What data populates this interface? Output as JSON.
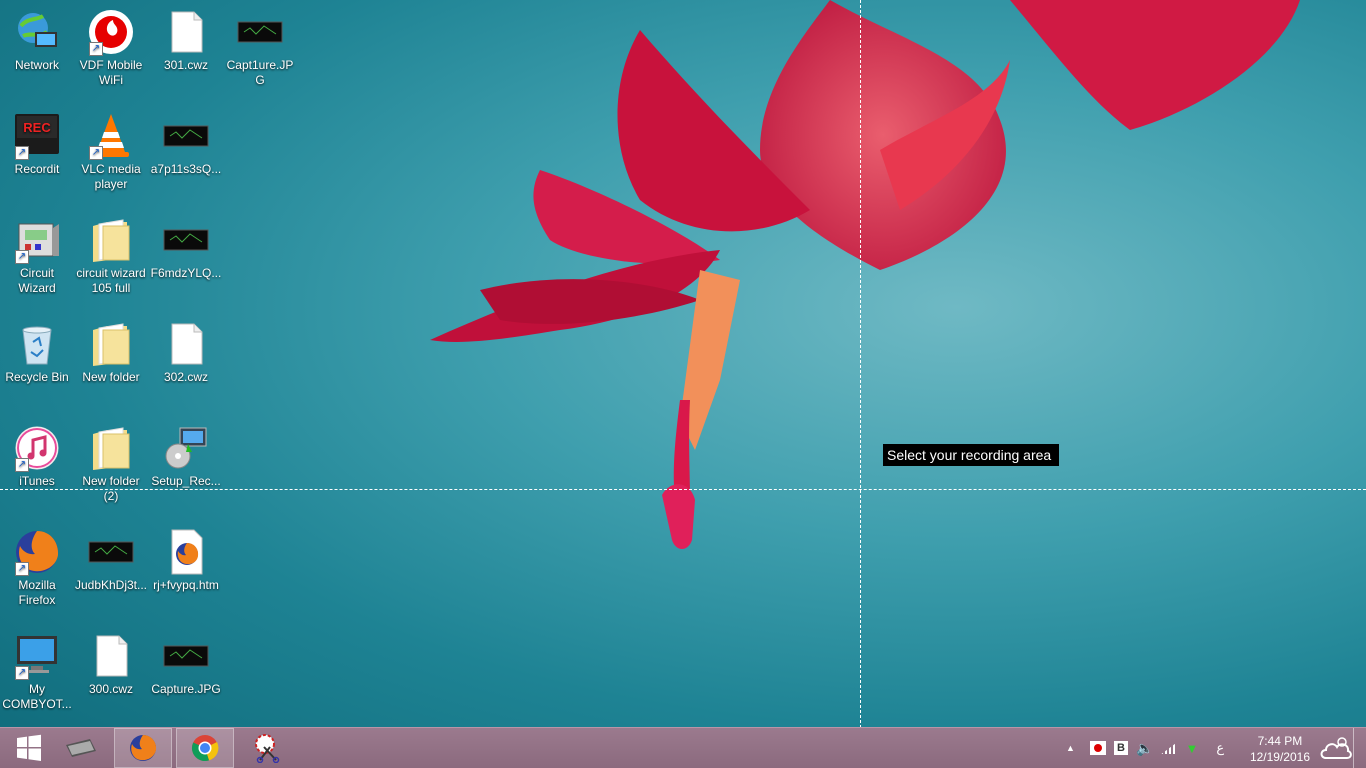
{
  "desktop": {
    "icons": [
      {
        "label": "Network",
        "shortcut": false,
        "icon": "network-icon"
      },
      {
        "label": "VDF Mobile WiFi",
        "shortcut": true,
        "icon": "vodafone-icon"
      },
      {
        "label": "301.cwz",
        "shortcut": false,
        "icon": "file-icon"
      },
      {
        "label": "Capt1ure.JPG",
        "shortcut": false,
        "icon": "image-icon"
      },
      {
        "label": "Recordit",
        "shortcut": true,
        "icon": "recordit-icon",
        "badge": "REC"
      },
      {
        "label": "VLC media player",
        "shortcut": true,
        "icon": "vlc-icon"
      },
      {
        "label": "a7p11s3sQ...",
        "shortcut": false,
        "icon": "image-icon"
      },
      {
        "label": "Circuit Wizard",
        "shortcut": true,
        "icon": "circuit-wizard-icon"
      },
      {
        "label": "circuit wizard 105 full",
        "shortcut": false,
        "icon": "folder-icon"
      },
      {
        "label": "F6mdzYLQ...",
        "shortcut": false,
        "icon": "image-icon"
      },
      {
        "label": "Recycle Bin",
        "shortcut": false,
        "icon": "recycle-bin-icon"
      },
      {
        "label": "New folder",
        "shortcut": false,
        "icon": "folder-icon"
      },
      {
        "label": "302.cwz",
        "shortcut": false,
        "icon": "file-icon"
      },
      {
        "label": "iTunes",
        "shortcut": true,
        "icon": "itunes-icon"
      },
      {
        "label": "New folder (2)",
        "shortcut": false,
        "icon": "folder-icon"
      },
      {
        "label": "Setup_Rec...",
        "shortcut": false,
        "icon": "installer-icon"
      },
      {
        "label": "Mozilla Firefox",
        "shortcut": true,
        "icon": "firefox-icon"
      },
      {
        "label": "JudbKhDj3t...",
        "shortcut": false,
        "icon": "image-icon"
      },
      {
        "label": "rj+fvypq.htm",
        "shortcut": false,
        "icon": "firefox-file-icon"
      },
      {
        "label": "My COMBYOT...",
        "shortcut": true,
        "icon": "computer-icon"
      },
      {
        "label": "300.cwz",
        "shortcut": false,
        "icon": "file-icon"
      },
      {
        "label": "Capture.JPG",
        "shortcut": false,
        "icon": "image-icon"
      }
    ]
  },
  "overlay": {
    "tooltip": "Select your recording area"
  },
  "taskbar": {
    "apps": [
      {
        "name": "start",
        "icon": "windows-start-icon"
      },
      {
        "name": "explorer",
        "icon": "file-explorer-icon"
      },
      {
        "name": "firefox",
        "icon": "firefox-icon"
      },
      {
        "name": "chrome",
        "icon": "chrome-icon"
      },
      {
        "name": "snipping",
        "icon": "snipping-tool-icon"
      }
    ],
    "tray": {
      "language": "ع",
      "time": "7:44 PM",
      "date": "12/19/2016"
    }
  },
  "colors": {
    "taskbar": "#8b6a7e",
    "tooltip_bg": "#000000",
    "accent_red": "#d7152f"
  }
}
